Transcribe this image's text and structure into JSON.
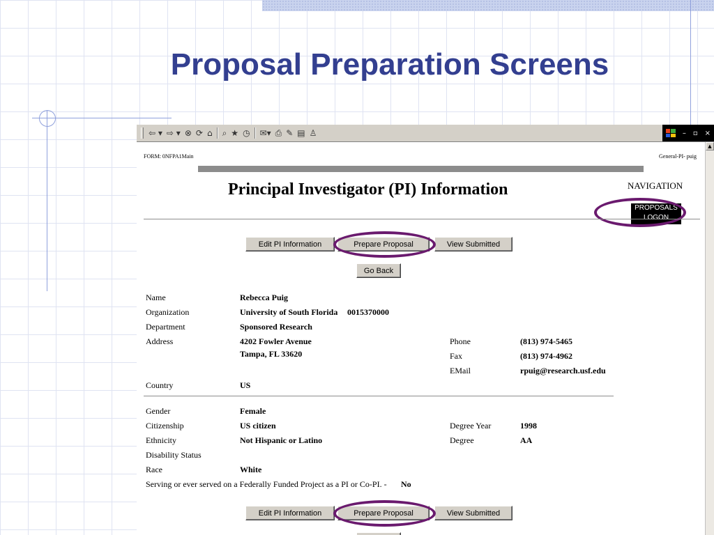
{
  "slide": {
    "title": "Proposal Preparation Screens"
  },
  "browser": {
    "toolbar_icons": [
      "back-icon",
      "forward-icon",
      "stop-icon",
      "refresh-icon",
      "home-icon",
      "search-icon",
      "favorites-icon",
      "history-icon",
      "mail-icon",
      "print-icon",
      "edit-icon",
      "discuss-icon",
      "messenger-icon"
    ],
    "window_controls": [
      "–",
      "×"
    ]
  },
  "page": {
    "form_id": "FORM: 0NFPA1Main",
    "user_id": "General-PI- puig",
    "title": "Principal Investigator (PI) Information",
    "navigation_label": "NAVIGATION",
    "nav_items": [
      "PROPOSALS",
      "LOGON"
    ],
    "buttons": {
      "edit_pi": "Edit PI Information",
      "prepare": "Prepare Proposal",
      "view_submitted": "View Submitted",
      "go_back": "Go Back"
    },
    "pi": {
      "name_label": "Name",
      "name": "Rebecca Puig",
      "org_label": "Organization",
      "org": "University of South Florida",
      "org_id": "0015370000",
      "dept_label": "Department",
      "dept": "Sponsored Research",
      "address_label": "Address",
      "address1": "4202 Fowler Avenue",
      "address2": "Tampa, FL 33620",
      "phone_label": "Phone",
      "phone": "(813) 974-5465",
      "fax_label": "Fax",
      "fax": "(813) 974-4962",
      "email_label": "EMail",
      "email": "rpuig@research.usf.edu",
      "country_label": "Country",
      "country": "US",
      "gender_label": "Gender",
      "gender": "Female",
      "citizenship_label": "Citizenship",
      "citizenship": "US citizen",
      "degree_year_label": "Degree Year",
      "degree_year": "1998",
      "ethnicity_label": "Ethnicity",
      "ethnicity": "Not Hispanic or Latino",
      "degree_label": "Degree",
      "degree": "AA",
      "disability_label": "Disability Status",
      "race_label": "Race",
      "race": "White",
      "federal_label": "Serving or ever served on a Federally Funded Project as a PI or Co-PI.  -",
      "federal": "No"
    }
  }
}
